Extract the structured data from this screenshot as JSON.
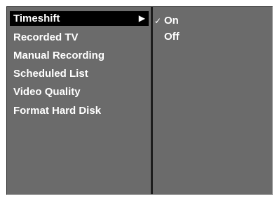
{
  "main_menu": {
    "items": [
      {
        "label": "Timeshift",
        "selected": true,
        "has_submenu": true
      },
      {
        "label": "Recorded TV"
      },
      {
        "label": "Manual Recording"
      },
      {
        "label": "Scheduled List"
      },
      {
        "label": "Video Quality"
      },
      {
        "label": "Format Hard Disk"
      }
    ],
    "submenu_arrow": "▶"
  },
  "sub_menu": {
    "check_mark": "✓",
    "options": [
      {
        "label": "On",
        "checked": true
      },
      {
        "label": "Off",
        "checked": false
      }
    ]
  },
  "colors": {
    "panel": "#6b6b6b",
    "highlight": "#000000",
    "text": "#ffffff",
    "divider": "#1c1c1c"
  }
}
